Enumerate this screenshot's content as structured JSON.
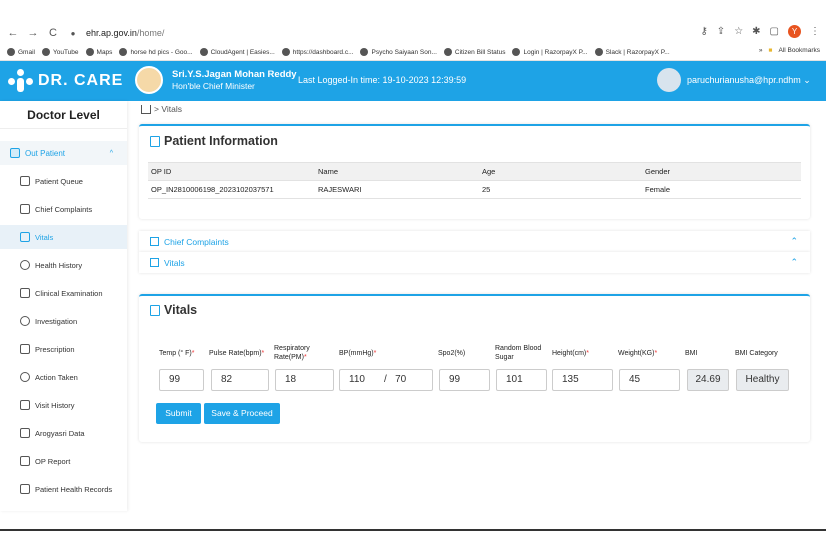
{
  "browser": {
    "url_host": "ehr.ap.gov.in",
    "url_path": "/home/",
    "bookmarks": [
      "Gmail",
      "YouTube",
      "Maps",
      "horse hd pics - Goo...",
      "CloudAgent | Easies...",
      "https://dashboard.c...",
      "Psycho Saiyaan Son...",
      "Citizen Bill Status",
      "Login | RazorpayX P...",
      "Slack | RazorpayX P..."
    ],
    "all_bookmarks": "All Bookmarks",
    "profile_initial": "Y"
  },
  "header": {
    "brand": "DR. CARE",
    "cm_name": "Sri.Y.S.Jagan Mohan Reddy",
    "cm_title": "Hon'ble Chief Minister",
    "last_login": "Last Logged-In time: 19-10-2023 12:39:59",
    "user_email": "paruchurianusha@hpr.ndhm"
  },
  "sidebar": {
    "title": "Doctor Level",
    "out_patient": "Out Patient",
    "items": [
      "Patient Queue",
      "Chief Complaints",
      "Vitals",
      "Health History",
      "Clinical Examination",
      "Investigation",
      "Prescription",
      "Action Taken",
      "Visit History",
      "Arogyasri Data",
      "OP Report",
      "Patient Health Records"
    ]
  },
  "breadcrumb": "Vitals",
  "patient_info": {
    "title": "Patient Information",
    "columns": [
      "OP ID",
      "Name",
      "Age",
      "Gender"
    ],
    "row": [
      "OP_IN2810006198_2023102037571",
      "RAJESWARI",
      "25",
      "Female"
    ]
  },
  "accordions": {
    "chief_complaints": "Chief Complaints",
    "vitals": "Vitals"
  },
  "vitals": {
    "title": "Vitals",
    "headers": {
      "temp": "Temp (° F)",
      "pulse": "Pulse Rate(bpm)",
      "resp1": "Respiratory",
      "resp2": "Rate(PM)",
      "bp": "BP(mmHg)",
      "spo2": "Spo2(%)",
      "rbs1": "Random Blood",
      "rbs2": "Sugar",
      "height": "Height(cm)",
      "weight": "Weight(KG)",
      "bmi": "BMI",
      "bmi_cat": "BMI Category"
    },
    "values": {
      "temp": "99",
      "pulse": "82",
      "resp": "18",
      "bp_sys": "110",
      "bp_slash": "/",
      "bp_dia": "70",
      "spo2": "99",
      "rbs": "101",
      "height": "135",
      "weight": "45",
      "bmi": "24.69",
      "bmi_cat": "Healthy"
    },
    "submit": "Submit",
    "save_proceed": "Save & Proceed"
  }
}
